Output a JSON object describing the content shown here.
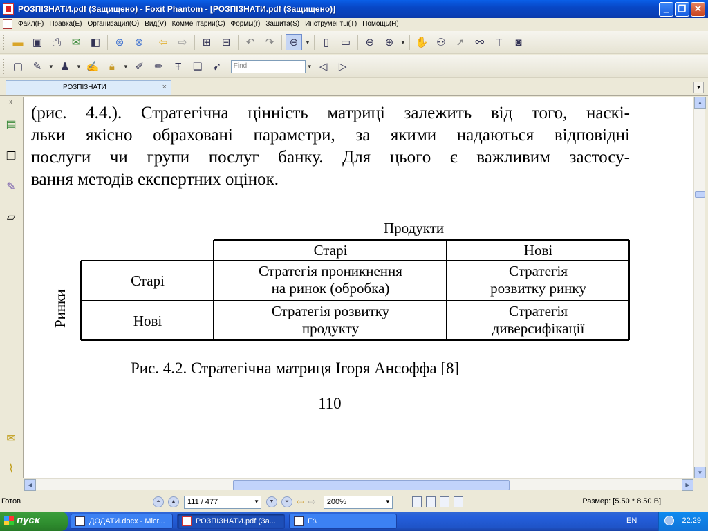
{
  "window": {
    "title": "РОЗПІЗНАТИ.pdf (Защищено) - Foxit Phantom - [РОЗПІЗНАТИ.pdf (Защищено)]",
    "min": "_",
    "max": "❐",
    "close": "✕"
  },
  "menu": [
    "Файл(F)",
    "Правка(E)",
    "Организация(O)",
    "Вид(V)",
    "Комментарии(C)",
    "Формы(r)",
    "Защита(S)",
    "Инструменты(T)",
    "Помощь(H)"
  ],
  "toolbar": {
    "find_placeholder": "Find"
  },
  "tab": {
    "label": "РОЗПІЗНАТИ",
    "close": "×"
  },
  "document": {
    "paragraph_lines": [
      "(рис. 4.4.). Стратегічна цінність матриці залежить від того, наскі-",
      "льки якісно обраховані параметри, за якими надаються відповідні",
      "послуги чи групи послуг банку. Для цього є важливим застосу-",
      "вання методів експертних оцінок."
    ],
    "matrix": {
      "top_header": "Продукти",
      "side_header": "Ринки",
      "col_headers": [
        "Старі",
        "Нові"
      ],
      "rows": [
        {
          "label": "Старі",
          "cells": [
            [
              "Стратегія проникнення",
              "на ринок (обробка)"
            ],
            [
              "Стратегія",
              "розвитку ринку"
            ]
          ]
        },
        {
          "label": "Нові",
          "cells": [
            [
              "Стратегія розвитку",
              "продукту"
            ],
            [
              "Стратегія",
              "диверсифікації"
            ]
          ]
        }
      ]
    },
    "caption": "Рис. 4.2. Стратегічна матриця Ігоря Ансоффа [8]",
    "page_number": "110"
  },
  "status": {
    "ready": "Готов",
    "page": "111 / 477",
    "zoom": "200%",
    "size": "Размер: [5.50 * 8.50 В]"
  },
  "taskbar": {
    "start": "пуск",
    "tasks": [
      "ДОДАТИ.docx - Micr...",
      "РОЗПІЗНАТИ.pdf (За...",
      "F:\\"
    ],
    "lang": "EN",
    "clock": "22:29"
  }
}
